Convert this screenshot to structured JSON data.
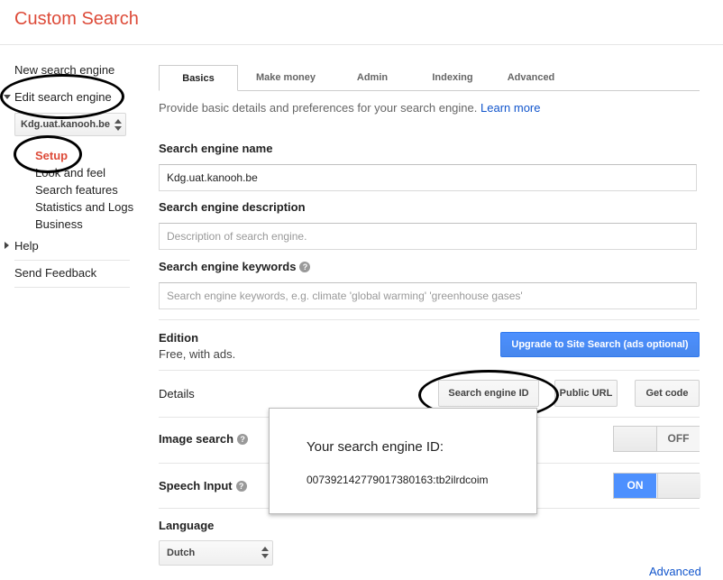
{
  "app": {
    "title": "Custom Search"
  },
  "sidebar": {
    "new_engine": "New search engine",
    "edit_engine": "Edit search engine",
    "engine_select": "Kdg.uat.kanooh.be",
    "sub_items": [
      "Setup",
      "Look and feel",
      "Search features",
      "Statistics and Logs",
      "Business"
    ],
    "help": "Help",
    "feedback": "Send Feedback"
  },
  "tabs": [
    "Basics",
    "Make money",
    "Admin",
    "Indexing",
    "Advanced"
  ],
  "intro": {
    "text": "Provide basic details and preferences for your search engine.",
    "link": "Learn more"
  },
  "fields": {
    "name_label": "Search engine name",
    "name_value": "Kdg.uat.kanooh.be",
    "desc_label": "Search engine description",
    "desc_placeholder": "Description of search engine.",
    "keywords_label": "Search engine keywords",
    "keywords_placeholder": "Search engine keywords, e.g. climate 'global warming' 'greenhouse gases'"
  },
  "edition": {
    "label": "Edition",
    "value": "Free, with ads.",
    "upgrade_button": "Upgrade to Site Search (ads optional)"
  },
  "details": {
    "label": "Details",
    "id_button": "Search engine ID",
    "public_url_button": "Public URL",
    "get_code_button": "Get code"
  },
  "image_search": {
    "label": "Image search",
    "state": "OFF"
  },
  "speech_input": {
    "label": "Speech Input",
    "state": "ON"
  },
  "popup": {
    "title": "Your search engine ID:",
    "id": "007392142779017380163:tb2ilrdcoim"
  },
  "language": {
    "label": "Language",
    "value": "Dutch"
  },
  "footer": {
    "advanced_link": "Advanced"
  },
  "colors": {
    "accent": "#dd4b39",
    "link": "#1155cc",
    "primary_button": "#4d90fe",
    "annotation": "#000000"
  }
}
